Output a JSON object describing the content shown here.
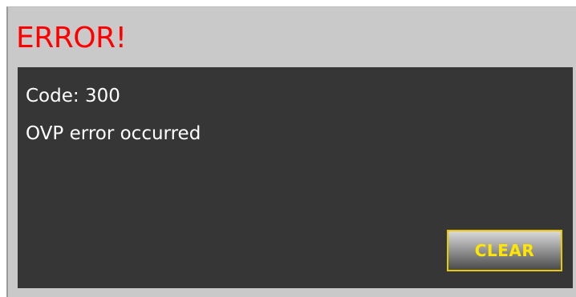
{
  "dialog": {
    "title": "ERROR!",
    "code_line": "Code: 300",
    "message": "OVP error occurred",
    "clear_label": "CLEAR"
  },
  "colors": {
    "title": "#ff0000",
    "panel_background": "#363636",
    "dialog_background": "#c9c9c9",
    "button_text": "#ffe600",
    "button_border": "#e8c800"
  }
}
